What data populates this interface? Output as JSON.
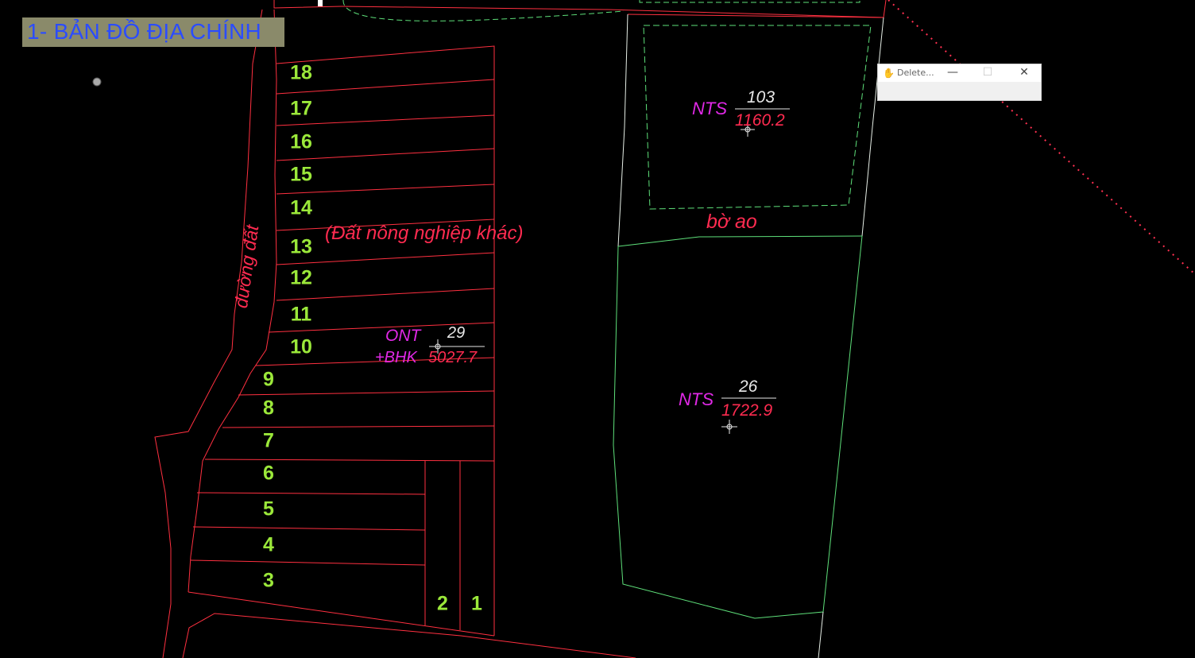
{
  "map_title": "1- BẢN ĐỒ ĐỊA CHÍNH",
  "lot_numbers": [
    "18",
    "17",
    "16",
    "15",
    "14",
    "13",
    "12",
    "11",
    "10",
    "9",
    "8",
    "7",
    "6",
    "5",
    "4",
    "3",
    "2",
    "1"
  ],
  "labels": {
    "road": "đường đất",
    "other_agri": "(Đất nông nghiệp khác)",
    "pond_bank": "bờ ao"
  },
  "parcels": [
    {
      "type": "NTS",
      "number": "103",
      "area": "1160.2"
    },
    {
      "type": "NTS",
      "number": "26",
      "area": "1722.9"
    },
    {
      "type": "ONT",
      "type2": "+BHK",
      "number": "29",
      "area": "5027.7"
    }
  ],
  "dialog": {
    "title": "Delete...",
    "icon": "hand-icon",
    "minimize": "—",
    "maximize": "☐",
    "close": "✕"
  },
  "colors": {
    "background": "#000000",
    "boundary": "#ff3040",
    "green_line": "#5ee07a",
    "lot_number": "#9be83a",
    "land_type": "#e028e6",
    "area": "#ff2b50",
    "title_text": "#2b4cff",
    "title_bg": "#8a8a6a"
  }
}
